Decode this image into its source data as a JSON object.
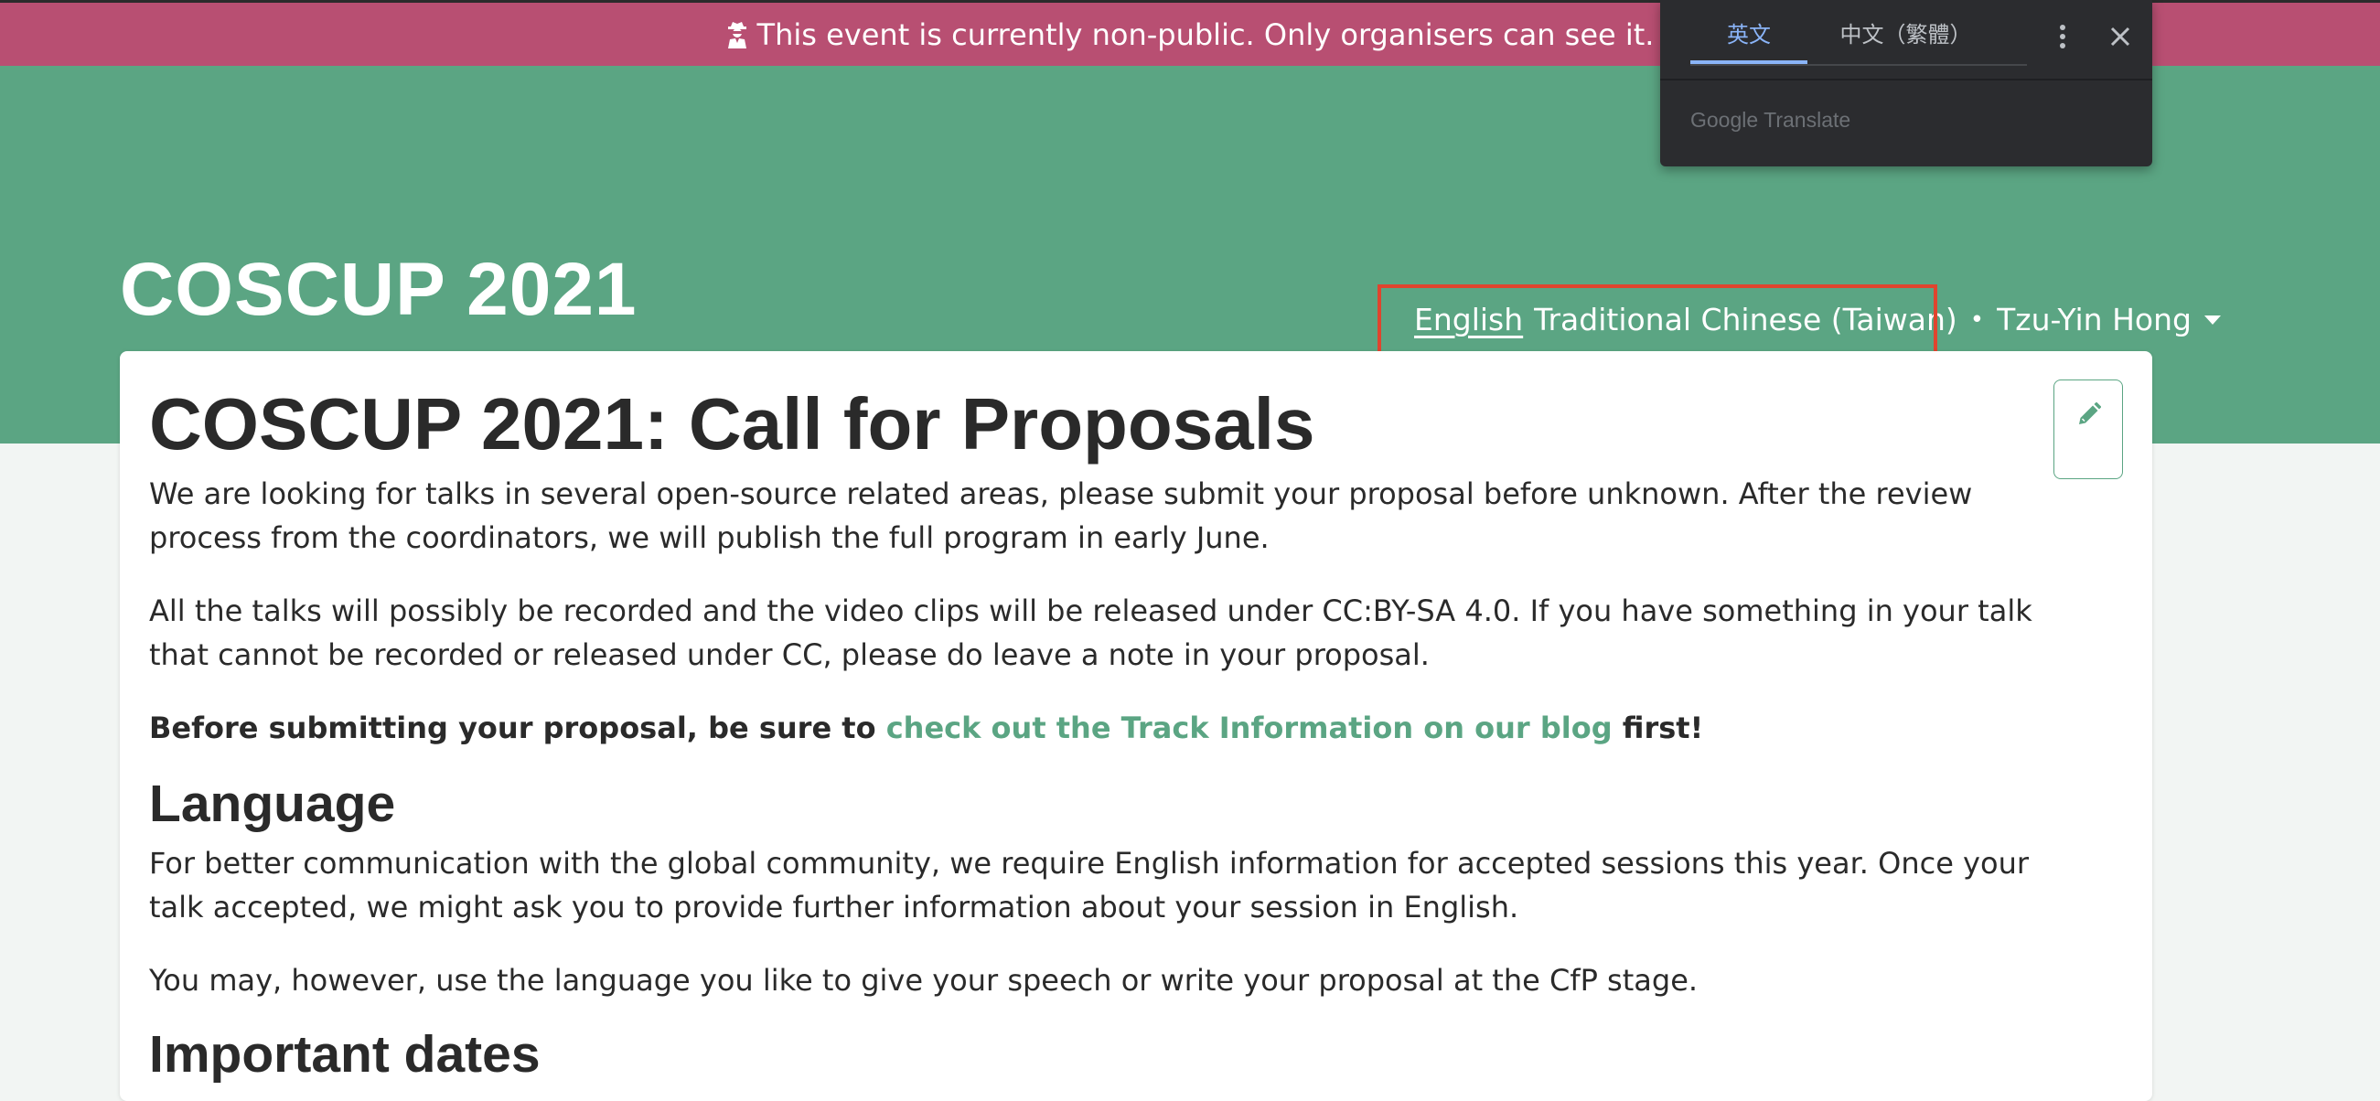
{
  "banner": {
    "text": "This event is currently non-public. Only organisers can see it.",
    "icon": "user-secret-icon"
  },
  "header": {
    "site_title": "COSCUP 2021",
    "lang_english": "English",
    "lang_chinese": "Traditional Chinese (Taiwan)",
    "separator": "•",
    "user_name": "Tzu-Yin Hong"
  },
  "page": {
    "title": "COSCUP 2021: Call for Proposals",
    "intro": "We are looking for talks in several open-source related areas, please submit your proposal before unknown. After the review process from the coordinators, we will publish the full program in early June.",
    "recording": "All the talks will possibly be recorded and the video clips will be released under CC:BY-SA 4.0. If you have something in your talk that cannot be recorded or released under CC, please do leave a note in your proposal.",
    "before_bold": "Before submitting your proposal, be sure to ",
    "link_text": "check out the Track Information on our blog",
    "after_bold": " first!",
    "language_heading": "Language",
    "language_p1": "For better communication with the global community, we require English information for accepted sessions this year. Once your talk accepted, we might ask you to provide further information about your session in English.",
    "language_p2": "You may, however, use the language you like to give your speech or write your proposal at the CfP stage.",
    "dates_heading": "Important dates"
  },
  "translate_popup": {
    "tab_english": "英文",
    "tab_chinese": "中文（繁體）",
    "brand": "Google Translate"
  },
  "colors": {
    "banner": "#b84f72",
    "hero": "#5ba583",
    "link": "#5ba583",
    "highlight": "#e0442e",
    "popup_bg": "#2b2c2f",
    "popup_active": "#8ab4f8"
  }
}
